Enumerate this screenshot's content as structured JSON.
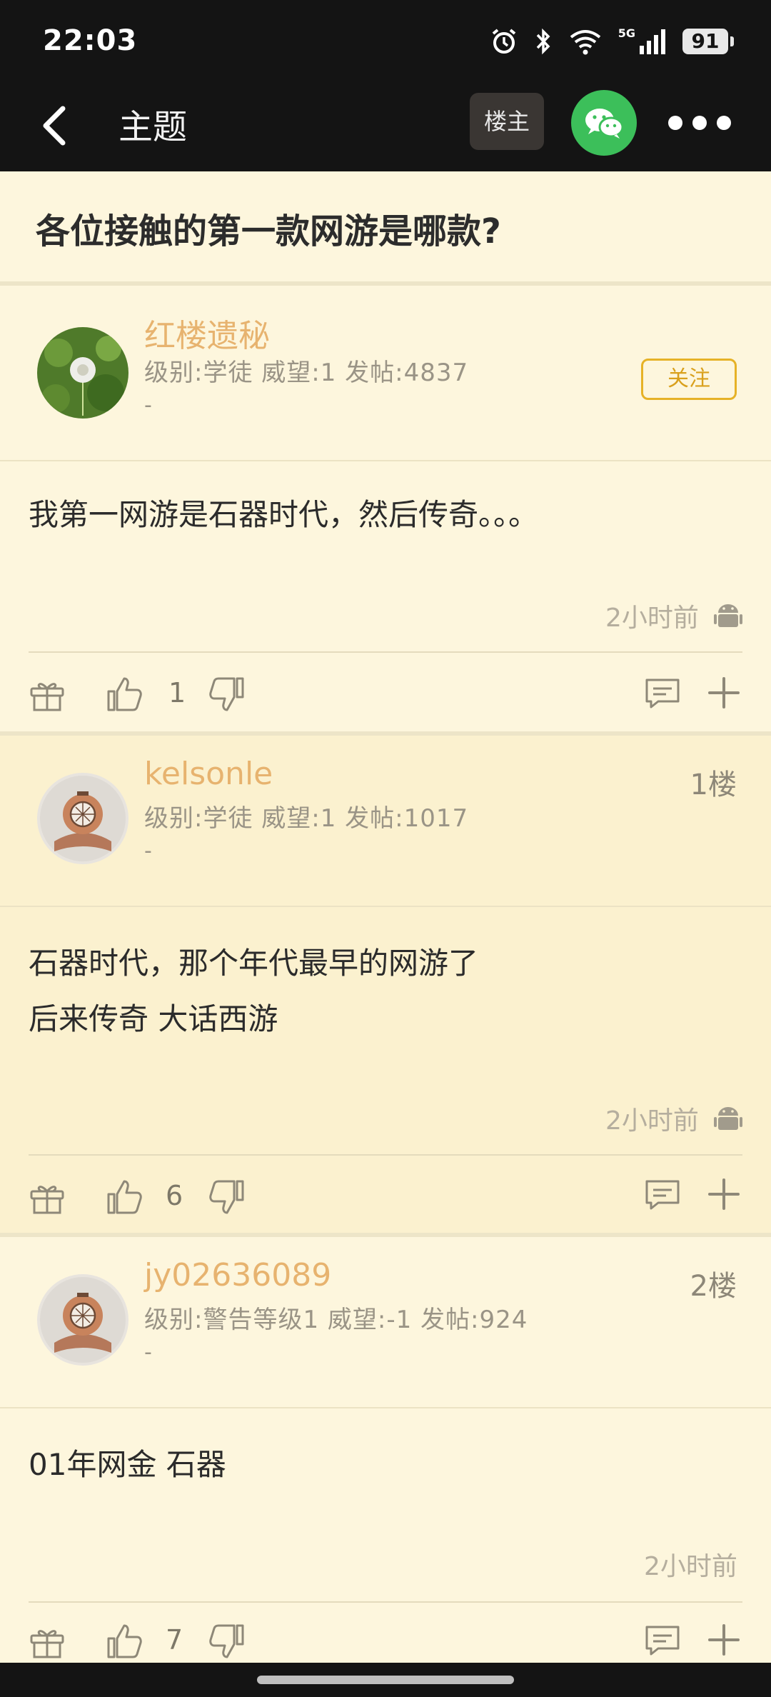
{
  "status_bar": {
    "time": "22:03",
    "network": "5G",
    "battery": "91"
  },
  "top_bar": {
    "title": "主题",
    "louzhu_label": "楼主"
  },
  "thread": {
    "title": "各位接触的第一款网游是哪款?"
  },
  "op_post": {
    "username": "红楼遗秘",
    "meta": "级别:学徒 威望:1 发帖:4837",
    "dash": "-",
    "follow_label": "关注",
    "content": "我第一网游是石器时代，然后传奇。。。",
    "time": "2小时前",
    "likes": "1"
  },
  "replies": [
    {
      "username": "kelsonle",
      "floor": "1楼",
      "meta": "级别:学徒 威望:1 发帖:1017",
      "dash": "-",
      "content_line1": "石器时代，那个年代最早的网游了",
      "content_line2": "后来传奇 大话西游",
      "time": "2小时前",
      "likes": "6"
    },
    {
      "username": "jy02636089",
      "floor": "2楼",
      "meta": "级别:警告等级1 威望:-1 发帖:924",
      "dash": "-",
      "content_line1": "01年网金 石器",
      "time": "2小时前",
      "likes": "7"
    }
  ],
  "colors": {
    "username": "#e7b36f",
    "follow": "#e6b227",
    "wechat": "#3cbf5a",
    "bar": "#141414"
  }
}
